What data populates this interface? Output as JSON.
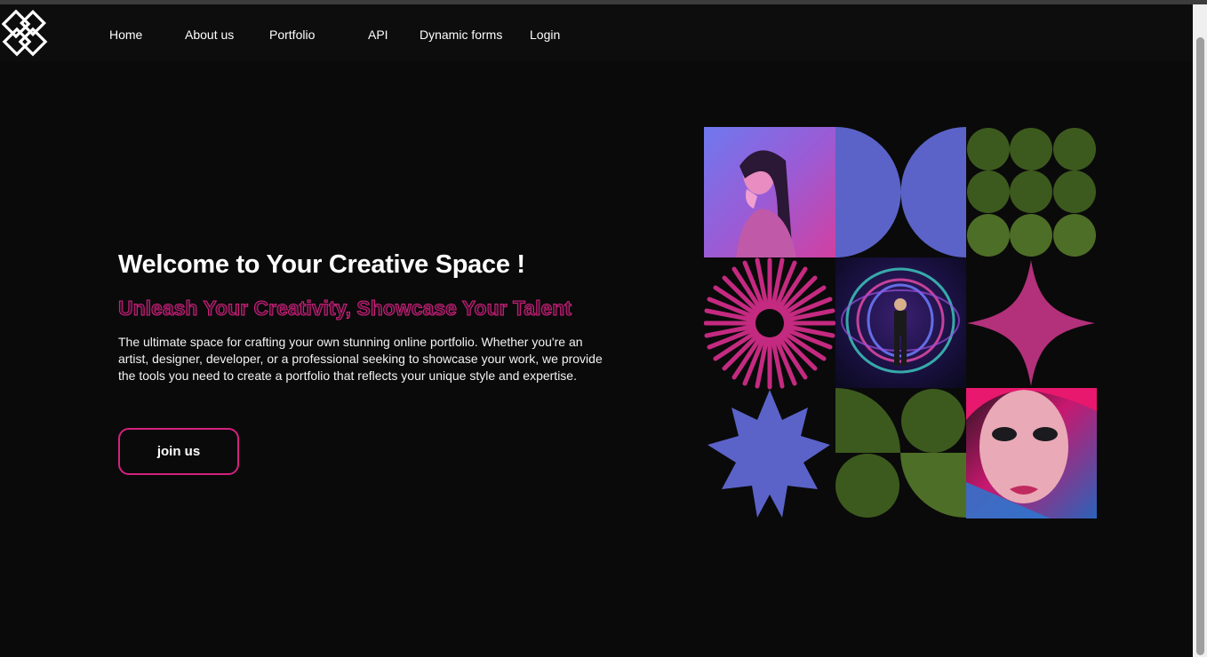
{
  "nav": {
    "links": [
      {
        "label": "Home"
      },
      {
        "label": "About us"
      },
      {
        "label": "Portfolio"
      },
      {
        "label": "API"
      },
      {
        "label": "Dynamic forms"
      },
      {
        "label": "Login"
      }
    ]
  },
  "hero": {
    "title": "Welcome to Your Creative Space !",
    "subtitle": "Unleash Your Creativity, Showcase Your Talent",
    "description": "The ultimate space for crafting your own stunning online portfolio. Whether you're an artist, designer, developer, or a professional seeking to showcase your work, we provide the tools you need to create a portfolio that reflects your unique style and expertise.",
    "cta_label": "join us"
  },
  "collage": {
    "tiles": [
      {
        "icon": "portrait-photo-icon"
      },
      {
        "icon": "half-circles-icon"
      },
      {
        "icon": "dot-grid-icon"
      },
      {
        "icon": "sunburst-icon"
      },
      {
        "icon": "light-painting-photo-icon"
      },
      {
        "icon": "four-point-star-icon"
      },
      {
        "icon": "eight-point-star-icon"
      },
      {
        "icon": "quarter-circles-icon"
      },
      {
        "icon": "makeup-portrait-photo-icon"
      }
    ]
  },
  "colors": {
    "background": "#0a0a0a",
    "accent_pink": "#d4217e",
    "periwinkle": "#5b63c9",
    "olive": "#3d5a1e",
    "magenta_star": "#b3307a"
  }
}
